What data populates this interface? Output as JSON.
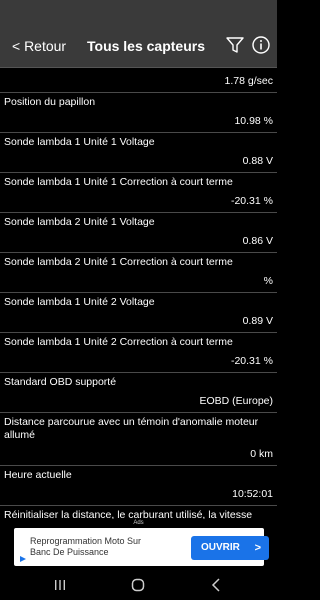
{
  "header": {
    "back_label": "< Retour",
    "title": "Tous les capteurs"
  },
  "sensors": [
    {
      "label": "",
      "value": "1.78 g/sec"
    },
    {
      "label": "Position du papillon",
      "value": "10.98 %"
    },
    {
      "label": "Sonde lambda 1 Unité 1 Voltage",
      "value": "0.88 V"
    },
    {
      "label": "Sonde lambda 1 Unité 1 Correction à court terme",
      "value": "-20.31 %"
    },
    {
      "label": "Sonde lambda 2 Unité 1 Voltage",
      "value": "0.86 V"
    },
    {
      "label": "Sonde lambda 2 Unité 1 Correction à court terme",
      "value": "%"
    },
    {
      "label": "Sonde lambda 1 Unité 2 Voltage",
      "value": "0.89 V"
    },
    {
      "label": "Sonde lambda 1 Unité 2 Correction à court terme",
      "value": "-20.31 %"
    },
    {
      "label": "Standard OBD  supporté",
      "value": "EOBD (Europe)"
    },
    {
      "label": "Distance parcourue avec un témoin d'anomalie moteur allumé",
      "value": "0 km"
    },
    {
      "label": "Heure actuelle",
      "value": "10:52:01"
    },
    {
      "label": "Réinitialiser la distance, le carburant utilisé, la vitesse",
      "value": ""
    }
  ],
  "ad": {
    "ads_label": "Ads",
    "text": "Reprogrammation Moto Sur Banc De Puissance",
    "button_label": "OUVRIR",
    "button_chevron": ">"
  }
}
